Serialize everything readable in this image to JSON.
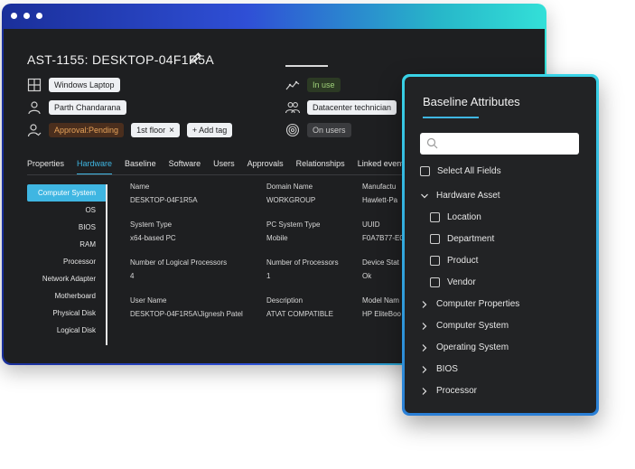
{
  "asset": {
    "title": "AST-1155: DESKTOP-04F1R5A",
    "type_chip": "Windows Laptop",
    "user_chip": "Parth Chandarana",
    "approval_chip": "Approval:Pending",
    "floor_tag": "1st floor",
    "add_tag_label": "+ Add tag",
    "status_chip": "In use",
    "role_chip": "Datacenter technician",
    "onusers_chip": "On users"
  },
  "tabs": [
    "Properties",
    "Hardware",
    "Baseline",
    "Software",
    "Users",
    "Approvals",
    "Relationships",
    "Linked events"
  ],
  "sidebar": [
    "Computer System",
    "OS",
    "BIOS",
    "RAM",
    "Processor",
    "Network Adapter",
    "Motherboard",
    "Physical Disk",
    "Logical Disk"
  ],
  "fields": {
    "name_label": "Name",
    "name_value": "DESKTOP-04F1R5A",
    "domain_label": "Domain Name",
    "domain_value": "WORKGROUP",
    "manu_label": "Manufactu",
    "manu_value": "Hawlett-Pa",
    "systype_label": "System Type",
    "systype_value": "x64-based PC",
    "pcsys_label": "PC System Type",
    "pcsys_value": "Mobile",
    "uuid_label": "UUID",
    "uuid_value": "F0A7B77-E0",
    "logproc_label": "Number of Logical Processors",
    "logproc_value": "4",
    "numproc_label": "Number of Processors",
    "numproc_value": "1",
    "devstat_label": "Device Stat",
    "devstat_value": "Ok",
    "username_label": "User Name",
    "username_value": "DESKTOP-04F1R5A\\Jignesh Patel",
    "desc_label": "Description",
    "desc_value": "AT\\AT COMPATIBLE",
    "model_label": "Model Nam",
    "model_value": "HP EliteBoo"
  },
  "popup": {
    "title": "Baseline Attributes",
    "search_placeholder": "",
    "select_all": "Select All Fields",
    "hardware_asset": "Hardware Asset",
    "hw_items": [
      "Location",
      "Department",
      "Product",
      "Vendor"
    ],
    "groups": [
      "Computer Properties",
      "Computer System",
      "Operating System",
      "BIOS",
      "Processor"
    ]
  }
}
